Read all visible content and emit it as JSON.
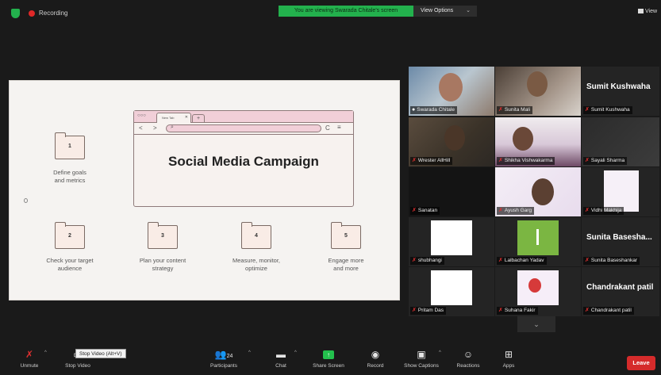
{
  "topbar": {
    "recording_label": "Recording",
    "viewing_banner": "You are viewing Swarada Chitale's screen",
    "view_options_label": "View Options",
    "view_label": "View"
  },
  "slide": {
    "headline": "Social Media Campaign",
    "tab_text": "New Tab",
    "steps": [
      {
        "num": "1",
        "label_line1": "Define goals",
        "label_line2": "and metrics"
      },
      {
        "num": "2",
        "label_line1": "Check your target",
        "label_line2": "audience"
      },
      {
        "num": "3",
        "label_line1": "Plan your content",
        "label_line2": "strategy"
      },
      {
        "num": "4",
        "label_line1": "Measure, monitor,",
        "label_line2": "optimize"
      },
      {
        "num": "5",
        "label_line1": "Engage more",
        "label_line2": "and more"
      }
    ]
  },
  "participants": [
    {
      "name": "Swarada Chitale",
      "mic": "on"
    },
    {
      "name": "Sunita Mali",
      "mic": "muted"
    },
    {
      "name": "Sumit Kushwaha",
      "big_name": "Sumit Kushwaha",
      "mic": "muted"
    },
    {
      "name": "Wrester AllHill",
      "mic": "muted"
    },
    {
      "name": "Shikha Vishwakarma",
      "mic": "muted"
    },
    {
      "name": "Sayali Sharma",
      "mic": "muted"
    },
    {
      "name": "Sanatan",
      "mic": "muted"
    },
    {
      "name": "Ayush Garg",
      "mic": "muted"
    },
    {
      "name": "Vidhi Makhija",
      "mic": "muted"
    },
    {
      "name": "shubhangi",
      "mic": "muted"
    },
    {
      "name": "Lalbachan Yadav",
      "mic": "muted"
    },
    {
      "name": "Sunita Baseshankar",
      "big_name": "Sunita Basesha...",
      "mic": "muted"
    },
    {
      "name": "Pritam Das",
      "mic": "muted"
    },
    {
      "name": "Suhana Fakir",
      "mic": "muted"
    },
    {
      "name": "Chandrakant patil",
      "big_name": "Chandrakant patil",
      "mic": "muted"
    }
  ],
  "toolbar": {
    "unmute": "Unmute",
    "stop_video": "Stop Video",
    "stop_video_tooltip": "Stop Video (Alt+V)",
    "participants": "Participants",
    "participants_count": "24",
    "chat": "Chat",
    "share_screen": "Share Screen",
    "record": "Record",
    "show_captions": "Show Captions",
    "reactions": "Reactions",
    "apps": "Apps",
    "leave": "Leave"
  },
  "colors": {
    "accent_green": "#23b14d",
    "leave_red": "#d52b2b",
    "active_speaker_border": "#f4e84a",
    "browser_pink": "#f1cfd8"
  }
}
